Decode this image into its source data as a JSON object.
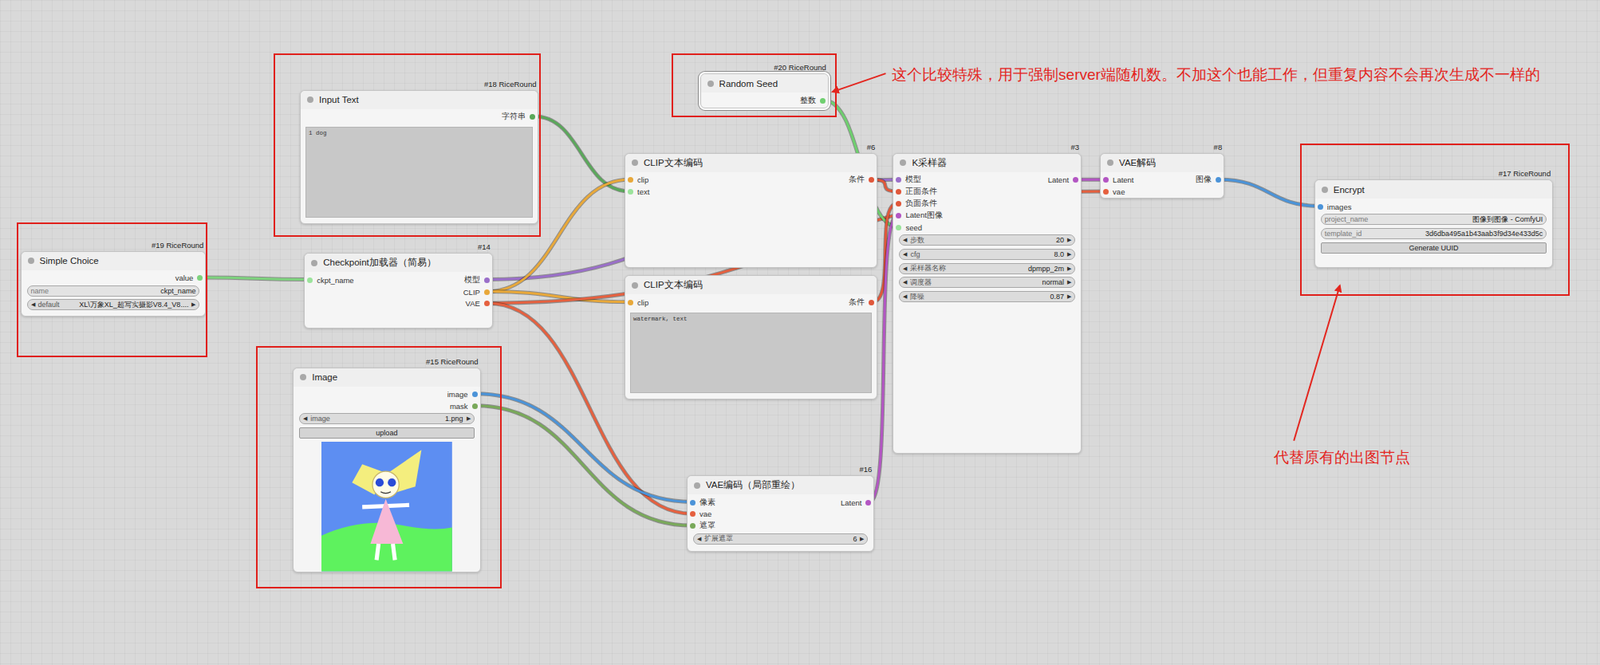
{
  "canvas": {
    "widget_arrows": [
      "◀",
      "▶"
    ]
  },
  "nodes": [
    {
      "title": "Simple Choice",
      "badge": "#19 RiceRound",
      "selected": false,
      "highlighted": true,
      "inputs": [],
      "outputs": [
        {
          "label": "value",
          "color": "#7ed37e"
        }
      ],
      "widgets": [
        {
          "kind": "text",
          "label": "name",
          "value": "ckpt_name"
        },
        {
          "kind": "combo",
          "label": "default",
          "value": "XL\\万象XL_超写实摄影V8.4_V8...."
        }
      ],
      "textarea": null,
      "preview": false
    },
    {
      "title": "Checkpoint加载器（简易）",
      "badge": "#14",
      "selected": false,
      "highlighted": false,
      "inputs": [
        {
          "label": "ckpt_name",
          "color": "#9be39b"
        }
      ],
      "outputs": [
        {
          "label": "模型",
          "color": "#9a6fc9"
        },
        {
          "label": "CLIP",
          "color": "#e8a83a"
        },
        {
          "label": "VAE",
          "color": "#e5603f"
        }
      ],
      "widgets": [],
      "textarea": null,
      "preview": false
    },
    {
      "title": "Input Text",
      "badge": "#18 RiceRound",
      "selected": false,
      "highlighted": true,
      "inputs": [],
      "outputs": [
        {
          "label": "字符串",
          "color": "#5aa85a"
        }
      ],
      "widgets": [],
      "textarea": "1 dog",
      "preview": false
    },
    {
      "title": "Image",
      "badge": "#15 RiceRound",
      "selected": false,
      "highlighted": true,
      "inputs": [],
      "outputs": [
        {
          "label": "image",
          "color": "#4b93d8"
        },
        {
          "label": "mask",
          "color": "#79a95a"
        }
      ],
      "widgets": [
        {
          "kind": "combo",
          "label": "image",
          "value": "1.png"
        },
        {
          "kind": "button",
          "label": "upload",
          "value": ""
        }
      ],
      "textarea": null,
      "preview": true
    },
    {
      "title": "Random Seed",
      "badge": "#20 RiceRound",
      "selected": true,
      "highlighted": true,
      "inputs": [],
      "outputs": [
        {
          "label": "整数",
          "color": "#6fcf6f"
        }
      ],
      "widgets": [],
      "textarea": null,
      "preview": false
    },
    {
      "title": "CLIP文本编码",
      "badge": "#6",
      "selected": false,
      "highlighted": false,
      "inputs": [
        {
          "label": "clip",
          "color": "#e8a83a"
        },
        {
          "label": "text",
          "color": "#9be39b"
        }
      ],
      "outputs": [
        {
          "label": "条件",
          "color": "#e0573a"
        }
      ],
      "widgets": [],
      "textarea": null,
      "preview": false
    },
    {
      "title": "CLIP文本编码",
      "badge": null,
      "selected": false,
      "highlighted": false,
      "inputs": [
        {
          "label": "clip",
          "color": "#e8a83a"
        }
      ],
      "outputs": [
        {
          "label": "条件",
          "color": "#e0573a"
        }
      ],
      "widgets": [],
      "textarea": "watermark, text",
      "preview": false
    },
    {
      "title": "VAE编码（局部重绘）",
      "badge": "#16",
      "selected": false,
      "highlighted": false,
      "inputs": [
        {
          "label": "像素",
          "color": "#4b93d8"
        },
        {
          "label": "vae",
          "color": "#e5603f"
        },
        {
          "label": "遮罩",
          "color": "#79a95a"
        }
      ],
      "outputs": [
        {
          "label": "Latent",
          "color": "#b356c3"
        }
      ],
      "widgets": [
        {
          "kind": "number",
          "label": "扩展遮罩",
          "value": "6"
        }
      ],
      "textarea": null,
      "preview": false
    },
    {
      "title": "K采样器",
      "badge": "#3",
      "selected": false,
      "highlighted": false,
      "inputs": [
        {
          "label": "模型",
          "color": "#9a6fc9"
        },
        {
          "label": "正面条件",
          "color": "#e0573a"
        },
        {
          "label": "负面条件",
          "color": "#e0573a"
        },
        {
          "label": "Latent图像",
          "color": "#b356c3"
        },
        {
          "label": "seed",
          "color": "#9be39b"
        }
      ],
      "outputs": [
        {
          "label": "Latent",
          "color": "#b356c3"
        }
      ],
      "widgets": [
        {
          "kind": "number",
          "label": "步数",
          "value": "20"
        },
        {
          "kind": "number",
          "label": "cfg",
          "value": "8.0"
        },
        {
          "kind": "combo",
          "label": "采样器名称",
          "value": "dpmpp_2m"
        },
        {
          "kind": "combo",
          "label": "调度器",
          "value": "normal"
        },
        {
          "kind": "number",
          "label": "降噪",
          "value": "0.87"
        }
      ],
      "textarea": null,
      "preview": false
    },
    {
      "title": "VAE解码",
      "badge": "#8",
      "selected": false,
      "highlighted": false,
      "inputs": [
        {
          "label": "Latent",
          "color": "#b356c3"
        },
        {
          "label": "vae",
          "color": "#e5603f"
        }
      ],
      "outputs": [
        {
          "label": "图像",
          "color": "#4b93d8"
        }
      ],
      "widgets": [],
      "textarea": null,
      "preview": false
    },
    {
      "title": "Encrypt",
      "badge": "#17 RiceRound",
      "selected": false,
      "highlighted": true,
      "inputs": [
        {
          "label": "images",
          "color": "#4b93d8"
        }
      ],
      "outputs": [],
      "widgets": [
        {
          "kind": "text",
          "label": "project_name",
          "value": "图像到图像 - ComfyUI"
        },
        {
          "kind": "text",
          "label": "template_id",
          "value": "3d6dba495a1b43aab3f9d34e433d5c"
        },
        {
          "kind": "button",
          "label": "Generate UUID",
          "value": ""
        }
      ],
      "textarea": null,
      "preview": false
    }
  ],
  "annotations": [
    {
      "text": "这个比较特殊，用于强制server端随机数。不加这个也能工作，但重复内容不会再次生成不一样的"
    },
    {
      "text": "代替原有的出图节点"
    }
  ]
}
